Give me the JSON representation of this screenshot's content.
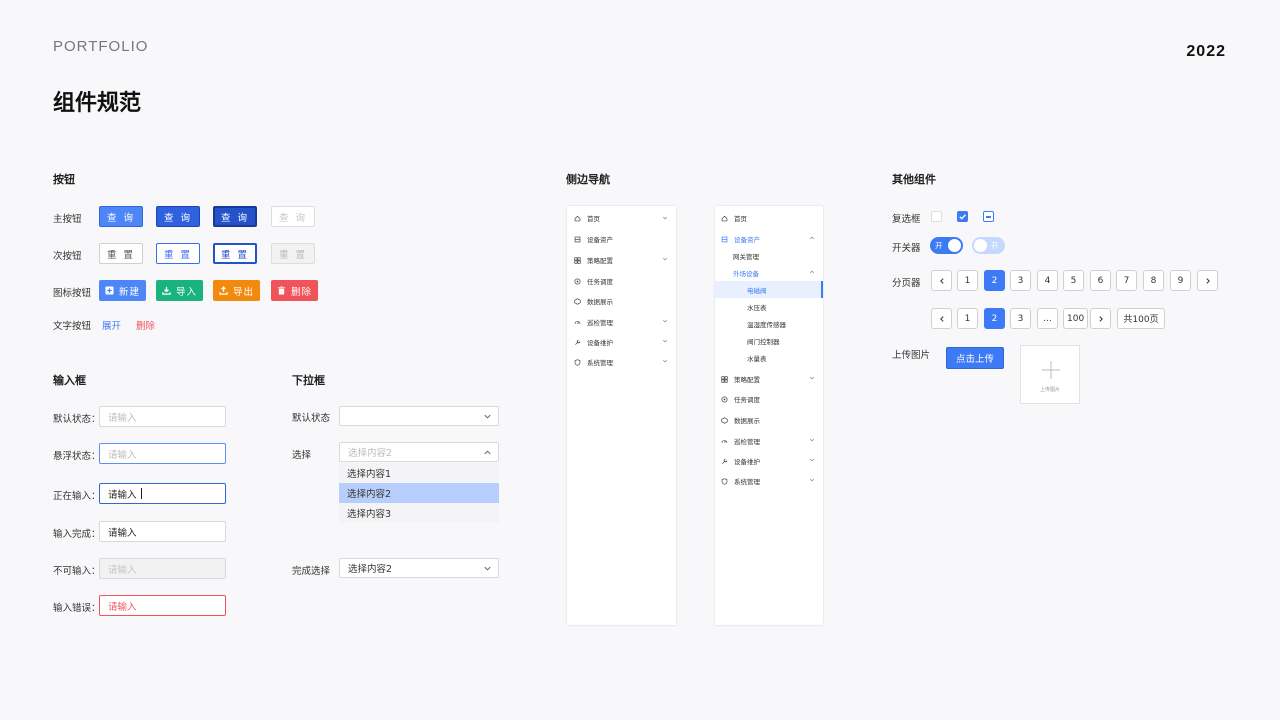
{
  "header": {
    "brand": "PORTFOLIO",
    "year": "2022",
    "title": "组件规范"
  },
  "buttons": {
    "section": "按钮",
    "primary_label": "主按钮",
    "primary": [
      "查 询",
      "查 询",
      "查 询",
      "查 询"
    ],
    "secondary_label": "次按钮",
    "secondary": [
      "重 置",
      "重 置",
      "重 置",
      "重 置"
    ],
    "icon_label": "图标按钮",
    "icon_buttons": [
      {
        "text": "新建",
        "icon": "plus-square-icon",
        "color": "#4d86f7"
      },
      {
        "text": "导入",
        "icon": "download-icon",
        "color": "#18b37e"
      },
      {
        "text": "导出",
        "icon": "upload-icon",
        "color": "#f28a0e"
      },
      {
        "text": "删除",
        "icon": "trash-icon",
        "color": "#f0535a"
      }
    ],
    "text_label": "文字按钮",
    "text_buttons": [
      "展开",
      "删除"
    ]
  },
  "inputs": {
    "section": "输入框",
    "rows": [
      {
        "label": "默认状态：",
        "value": "请输入"
      },
      {
        "label": "悬浮状态：",
        "value": "请输入"
      },
      {
        "label": "正在输入：",
        "value": "请输入"
      },
      {
        "label": "输入完成：",
        "value": "请输入"
      },
      {
        "label": "不可输入：",
        "value": "请输入"
      },
      {
        "label": "输入错误：",
        "value": "请输入"
      }
    ]
  },
  "dropdown": {
    "section": "下拉框",
    "default_label": "默认状态",
    "select_label": "选择",
    "select_placeholder": "选择内容2",
    "options": [
      "选择内容1",
      "选择内容2",
      "选择内容3"
    ],
    "done_label": "完成选择",
    "done_value": "选择内容2"
  },
  "sidenav": {
    "section": "侧边导航",
    "collapsed": [
      {
        "label": "首页",
        "icon": "home-icon"
      },
      {
        "label": "设备资产",
        "icon": "device-icon"
      },
      {
        "label": "策略配置",
        "icon": "grid-icon"
      },
      {
        "label": "任务调度",
        "icon": "task-icon"
      },
      {
        "label": "数据展示",
        "icon": "data-icon"
      },
      {
        "label": "巡检管理",
        "icon": "inspect-icon"
      },
      {
        "label": "设备维护",
        "icon": "maintain-icon"
      },
      {
        "label": "系统管理",
        "icon": "shield-icon"
      }
    ],
    "expanded": {
      "home": "首页",
      "device": "设备资产",
      "sub1": "网关管理",
      "sub2": "外场设备",
      "leaf": [
        "电磁阀",
        "水压表",
        "温湿度传感器",
        "阀门控制器",
        "水量表"
      ],
      "rest": [
        "策略配置",
        "任务调度",
        "数据展示",
        "巡检管理",
        "设备维护",
        "系统管理"
      ]
    }
  },
  "other": {
    "section": "其他组件",
    "checkbox_label": "复选框",
    "switch_label": "开关器",
    "switch_on": "开",
    "switch_off": "开",
    "pager_label": "分页器",
    "pager1": [
      "1",
      "2",
      "3",
      "4",
      "5",
      "6",
      "7",
      "8",
      "9"
    ],
    "pager2": [
      "1",
      "2",
      "3",
      "...",
      "100"
    ],
    "pager_total": "共100页",
    "upload_label": "上传图片",
    "upload_button": "点击上传",
    "upload_box_text": "上传图片"
  },
  "colors": {
    "primary": "#3d7af5",
    "danger": "#f0535a",
    "success": "#18b37e",
    "warning": "#f28a0e"
  }
}
